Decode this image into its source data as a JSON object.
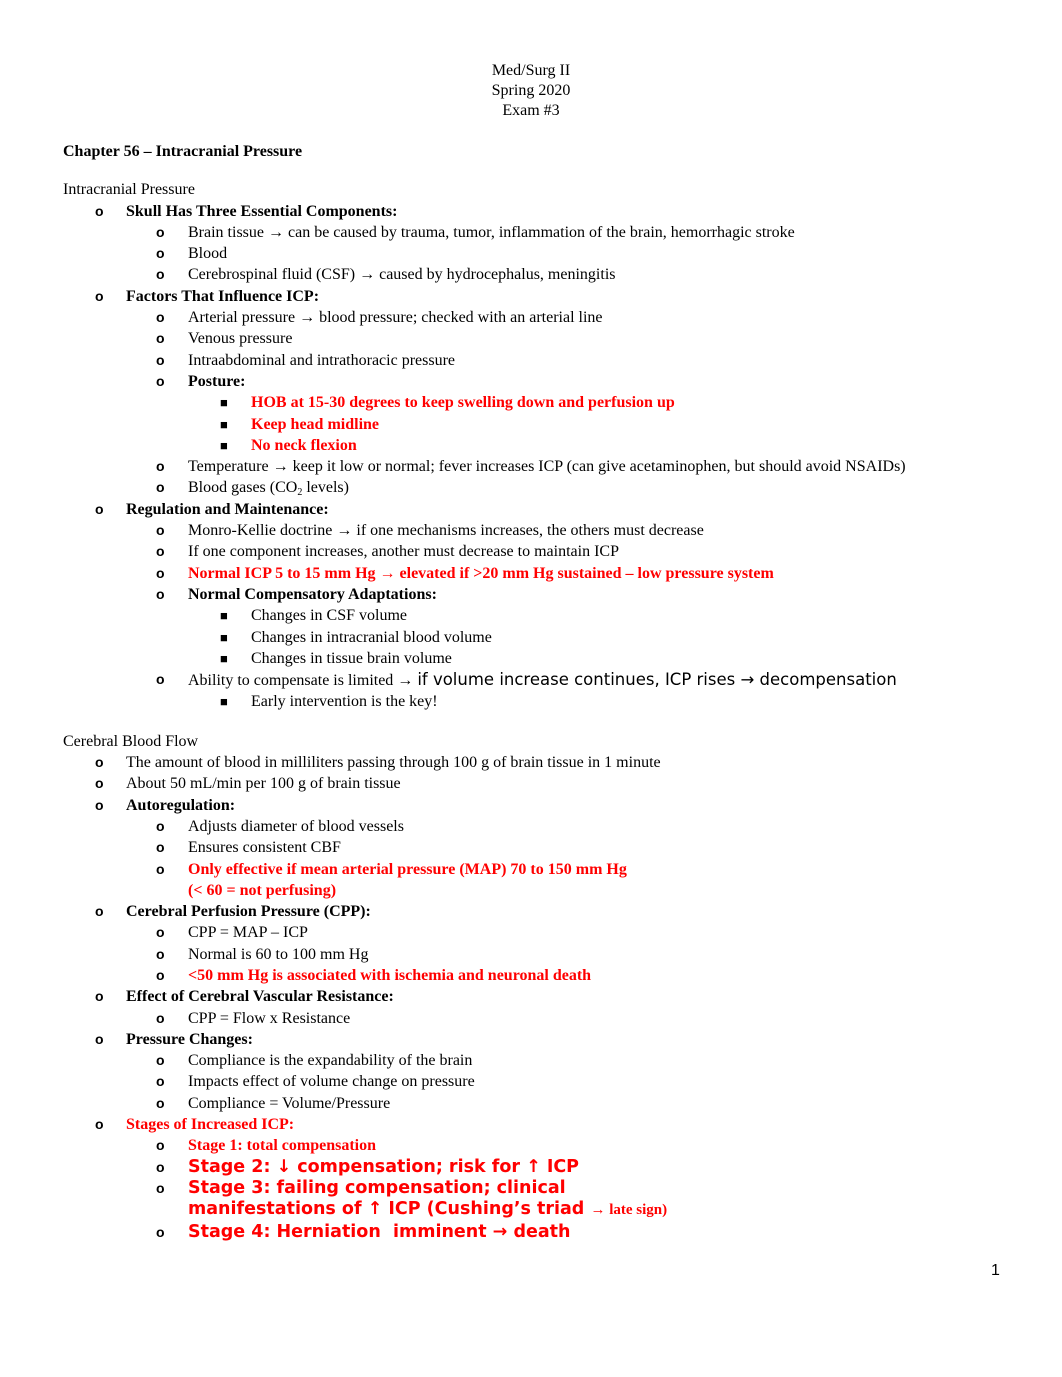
{
  "header": {
    "course": "Med/Surg II",
    "term": "Spring 2020",
    "exam": "Exam #3"
  },
  "chapter_title": "Chapter 56 – Intracranial Pressure",
  "sections": {
    "icp": {
      "title": "Intracranial Pressure",
      "skull": {
        "label": "Skull Has Three Essential Components:",
        "items": [
          "Brain tissue → can be caused by trauma, tumor, inflammation of the brain, hemorrhagic stroke",
          "Blood",
          "Cerebrospinal fluid (CSF) → caused by hydrocephalus, meningitis"
        ]
      },
      "factors": {
        "label": "Factors That Influence ICP:",
        "items": [
          "Arterial pressure → blood pressure; checked with an arterial line",
          "Venous pressure",
          "Intraabdominal and intrathoracic pressure"
        ],
        "posture_label": "Posture:",
        "posture_items": [
          "HOB at 15-30 degrees to keep swelling down and perfusion up",
          "Keep head midline",
          "No neck flexion"
        ],
        "temperature": "Temperature → keep it low or normal; fever increases ICP (can give acetaminophen, but should avoid NSAIDs)",
        "blood_gases_pre": "Blood gases (CO",
        "blood_gases_sub": "2",
        "blood_gases_post": " levels)"
      },
      "regulation": {
        "label": "Regulation and Maintenance:",
        "items": [
          "Monro-Kellie doctrine → if one mechanisms increases, the others must decrease",
          "If one component increases, another must decrease to maintain ICP"
        ],
        "normal_icp": "Normal ICP 5 to 15 mm Hg → elevated if >20 mm Hg sustained – low pressure system",
        "adaptations_label": "Normal Compensatory Adaptations:",
        "adaptations": [
          "Changes in CSF volume",
          "Changes in intracranial blood volume",
          "Changes in tissue brain volume"
        ],
        "ability_pre": "Ability to compensate is limited → ",
        "ability_post": "if volume increase continues, ICP rises → decompensation",
        "ability_sub": "Early intervention is the key!"
      }
    },
    "cbf": {
      "title": "Cerebral Blood Flow",
      "items": [
        "The amount of blood in milliliters passing through 100 g of brain tissue in 1 minute",
        "About 50 mL/min per 100 g of brain tissue"
      ],
      "autoregulation": {
        "label": "Autoregulation:",
        "items": [
          "Adjusts diameter of blood vessels",
          "Ensures consistent CBF"
        ],
        "map_line1": "Only effective if mean arterial pressure (MAP) 70 to 150 mm Hg",
        "map_line2": "(< 60 = not perfusing)"
      },
      "cpp": {
        "label": "Cerebral Perfusion Pressure (CPP):",
        "items": [
          "CPP = MAP – ICP",
          "Normal is 60 to 100 mm Hg"
        ],
        "warning": "<50 mm Hg is associated with ischemia and neuronal death"
      },
      "resistance": {
        "label": "Effect of Cerebral Vascular Resistance:",
        "items": [
          "CPP = Flow x Resistance"
        ]
      },
      "pressure": {
        "label": "Pressure Changes:",
        "items": [
          "Compliance is the expandability of the brain",
          "Impacts effect of volume change on pressure",
          "Compliance = Volume/Pressure"
        ]
      },
      "stages": {
        "label": "Stages of Increased ICP:",
        "stage1": "Stage 1: total compensation",
        "stage2": "Stage 2: ↓ compensation; risk for ↑ ICP",
        "stage3_line1": "Stage 3: failing compensation; clinical",
        "stage3_line2": "manifestations of ↑ ICP (Cushing’s triad ",
        "stage3_tail": "→ late sign)",
        "stage4": "Stage 4: Herniation  imminent → death"
      }
    }
  },
  "bullets": {
    "circle": "o",
    "square": "■"
  },
  "page_number": "1",
  "colors": {
    "text": "#000000",
    "emphasis_red": "#ff0000"
  }
}
